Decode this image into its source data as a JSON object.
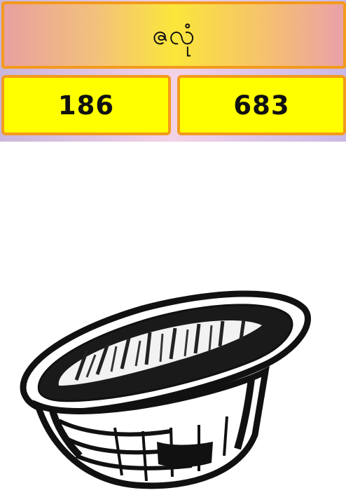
{
  "header": {
    "title": "ဇလုံ"
  },
  "numbers": {
    "left": "186",
    "right": "683"
  },
  "colors": {
    "box_fill": "#ffff00",
    "box_border": "#f39a1c"
  },
  "illustration": {
    "icon": "bowl-icon"
  }
}
